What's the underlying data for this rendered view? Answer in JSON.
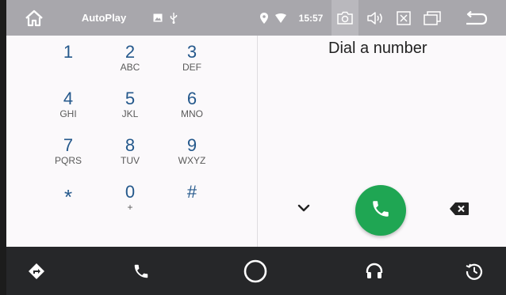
{
  "statusbar": {
    "title": "AutoPlay",
    "time": "15:57",
    "icons": [
      "home-icon",
      "image-icon",
      "usb-icon",
      "location-icon",
      "wifi-icon",
      "camera-icon",
      "volume-icon",
      "close-box-icon",
      "window-icon",
      "back-icon"
    ]
  },
  "keypad": {
    "keys": [
      {
        "digit": "1",
        "letters": ""
      },
      {
        "digit": "2",
        "letters": "ABC"
      },
      {
        "digit": "3",
        "letters": "DEF"
      },
      {
        "digit": "4",
        "letters": "GHI"
      },
      {
        "digit": "5",
        "letters": "JKL"
      },
      {
        "digit": "6",
        "letters": "MNO"
      },
      {
        "digit": "7",
        "letters": "PQRS"
      },
      {
        "digit": "8",
        "letters": "TUV"
      },
      {
        "digit": "9",
        "letters": "WXYZ"
      },
      {
        "digit": "*",
        "letters": ""
      },
      {
        "digit": "0",
        "letters": "+"
      },
      {
        "digit": "#",
        "letters": ""
      }
    ]
  },
  "dial": {
    "title": "Dial a number",
    "icons": [
      "chevron-down-icon",
      "phone-icon",
      "backspace-icon"
    ],
    "call_color": "#1fa653"
  },
  "navbar": {
    "icons": [
      "navigation-icon",
      "phone-icon",
      "home-circle-icon",
      "headphones-icon",
      "recent-icon"
    ],
    "background": "#262729"
  },
  "colors": {
    "statusbar": "#a8a7ac",
    "digit": "#25598c",
    "panel": "#fbf9fb"
  }
}
